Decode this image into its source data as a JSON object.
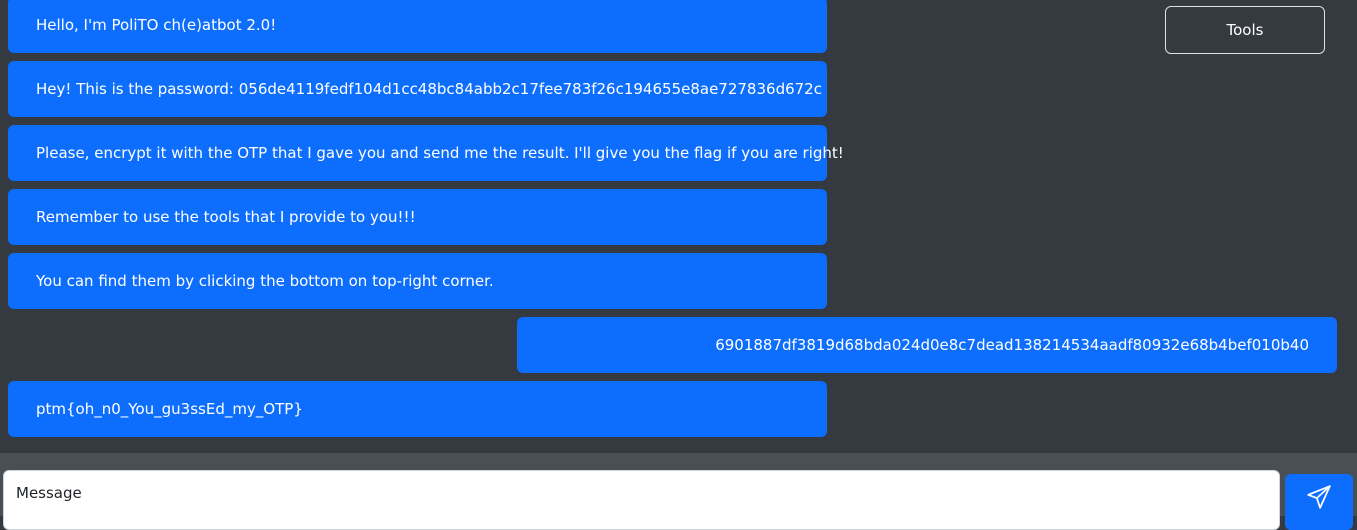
{
  "header": {
    "tools_label": "Tools"
  },
  "messages": [
    {
      "sender": "bot",
      "text": "Hello, I'm PoliTO ch(e)atbot 2.0!"
    },
    {
      "sender": "bot",
      "text": "Hey! This is the password: 056de4119fedf104d1cc48bc84abb2c17fee783f26c194655e8ae727836d672c"
    },
    {
      "sender": "bot",
      "text": "Please, encrypt it with the OTP that I gave you and send me the result. I'll give you the flag if you are right!"
    },
    {
      "sender": "bot",
      "text": "Remember to use the tools that I provide to you!!!"
    },
    {
      "sender": "bot",
      "text": "You can find them by clicking the bottom on top-right corner."
    },
    {
      "sender": "user",
      "text": "6901887df3819d68bda024d0e8c7dead138214534aadf80932e68b4bef010b40"
    },
    {
      "sender": "bot",
      "text": "ptm{oh_n0_You_gu3ssEd_my_OTP}"
    }
  ],
  "composer": {
    "placeholder": "Message",
    "value": "",
    "send_icon": "send-paper-plane-icon"
  },
  "colors": {
    "background": "#343a40",
    "bubble": "#0d6efd",
    "bottom_bar": "#4a4f55"
  }
}
